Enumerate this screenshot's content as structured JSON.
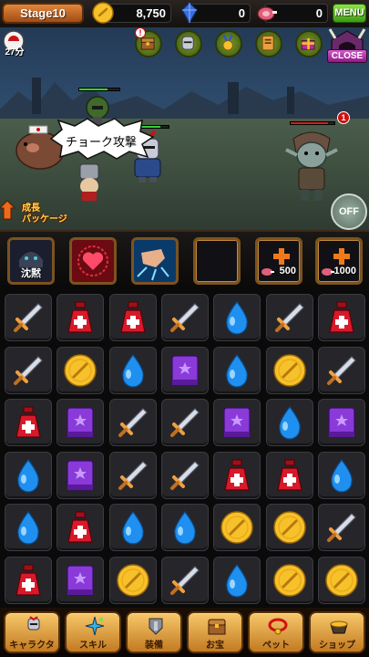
{
  "hud": {
    "stage": "Stage10",
    "coins": "8,750",
    "gems": "0",
    "meat": "0",
    "menu_label": "MENU"
  },
  "battle": {
    "time_left": "27分",
    "attack_callout": "チョーク攻撃",
    "enemy_count": "1",
    "close_label": "CLOSE",
    "quest_icons": [
      "treasure-chest-icon",
      "knight-helmet-icon",
      "medal-icon",
      "scroll-card-icon",
      "gift-box-icon"
    ],
    "growth_package": [
      "成長",
      "パッケージ"
    ],
    "auto_label": "OFF"
  },
  "skills": {
    "slots": [
      {
        "name": "silence-skill",
        "label": "沈黙"
      },
      {
        "name": "heart-skill",
        "label": ""
      },
      {
        "name": "frost-stomp-skill",
        "label": ""
      },
      {
        "name": "empty-skill-slot",
        "label": ""
      }
    ],
    "unlock_slots": [
      {
        "cost": "500"
      },
      {
        "cost": "1000"
      }
    ]
  },
  "board": {
    "rows": [
      [
        "sword",
        "potion",
        "potion",
        "sword",
        "drop",
        "sword",
        "potion"
      ],
      [
        "sword",
        "coin",
        "drop",
        "book",
        "drop",
        "coin",
        "sword"
      ],
      [
        "potion",
        "book",
        "sword",
        "sword",
        "book",
        "drop",
        "book"
      ],
      [
        "drop",
        "book",
        "sword",
        "sword",
        "potion",
        "potion",
        "drop"
      ],
      [
        "drop",
        "potion",
        "drop",
        "drop",
        "coin",
        "coin",
        "sword"
      ],
      [
        "potion",
        "book",
        "coin",
        "sword",
        "drop",
        "coin",
        "coin"
      ]
    ]
  },
  "nav": {
    "items": [
      {
        "label": "キャラクター",
        "icon": "knight-icon"
      },
      {
        "label": "スキル",
        "icon": "sparkle-icon"
      },
      {
        "label": "装備",
        "icon": "armor-icon"
      },
      {
        "label": "お宝",
        "icon": "treasure-icon"
      },
      {
        "label": "ペット",
        "icon": "collar-icon"
      },
      {
        "label": "ショップ",
        "icon": "pot-icon"
      }
    ]
  },
  "colors": {
    "coin": "#f6c12a",
    "gem": "#3a6fe0",
    "potion": "#d8192a",
    "drop": "#1f8ff0",
    "book": "#8a3ad8",
    "sword": "#d8dde6",
    "menu": "#5bbf2a",
    "close": "#c43cba"
  }
}
